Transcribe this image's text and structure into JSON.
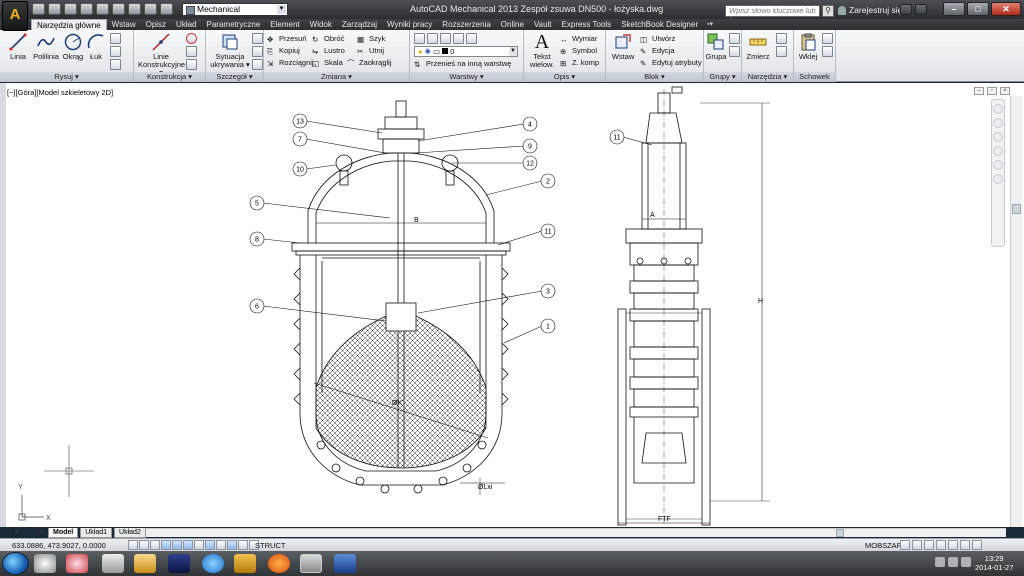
{
  "app": {
    "window_title": "AutoCAD Mechanical 2013     Zespół zsuwa DN500 - łożyska.dwg",
    "app_button_letter": "A",
    "workspace": "Mechanical",
    "search_placeholder": "Wpisz słowo kluczowe lub frazę",
    "sign_in": "Zarejestruj się"
  },
  "ribbon": {
    "tabs": [
      "Narzędzia główne",
      "Wstaw",
      "Opisz",
      "Układ",
      "Parametryczne",
      "Element",
      "Widok",
      "Zarządzaj",
      "Wyniki pracy",
      "Rozszerzenia",
      "Online",
      "Vault",
      "Express Tools",
      "SketchBook Designer"
    ],
    "tabs_toggle": "▪▾",
    "active_tab_index": 0,
    "panels": {
      "rysuj": {
        "title": "Rysuj ▾",
        "linia": "Linia",
        "polilinia": "Polilinia",
        "okrag": "Okrąg",
        "luk": "Łuk"
      },
      "konstrukcja": {
        "title": "Konstrukcja ▾",
        "linie": "Linie",
        "konstrukcyjne": "Konstrukcyjne ▾"
      },
      "szczegol": {
        "title": "Szczegół ▾",
        "sytuacja": "Sytuacja",
        "ukrywania": "ukrywania ▾"
      },
      "zmiana": {
        "title": "Zmiana ▾",
        "przesun": "Przesuń",
        "obroc": "Obróć",
        "szyk": "Szyk",
        "kopiuj": "Kopiuj",
        "lustro": "Lustro",
        "utnij": "Utnij",
        "rozciagnij": "Rozciągnij",
        "skala": "Skala",
        "zaokraglij": "Zaokrąglij"
      },
      "warstwy": {
        "title": "Warstwy ▾",
        "layer_value": "0",
        "przenies": "Przenieś na inną warstwę"
      },
      "opis": {
        "title": "Opis ▾",
        "tekst": "Tekst",
        "wielow": "wielow.",
        "wymiar": "Wymiar",
        "symbol": "Symbol",
        "zkomp": "Z. komp"
      },
      "blok": {
        "title": "Blok ▾",
        "wstaw": "Wstaw",
        "utworz": "Utwórz",
        "edycja": "Edycja",
        "edytuj_atrybuty": "Edytuj atrybuty"
      },
      "grupy": {
        "title": "Grupy ▾",
        "grupa": "Grupa"
      },
      "narzedzia": {
        "title": "Narzędzia ▾",
        "zmierz": "Zmierz"
      },
      "schowek": {
        "title": "Schowek",
        "wklej": "Wklej"
      }
    }
  },
  "viewport": {
    "label": "[−][Góra][Model szkieletowy 2D]"
  },
  "drawing": {
    "balloons_left": [
      "13",
      "7",
      "10",
      "5",
      "8",
      "6"
    ],
    "balloons_right": [
      "4",
      "9",
      "12",
      "2",
      "11",
      "3",
      "1"
    ],
    "balloon_side": "11",
    "dim_B": "B",
    "dim_A": "A",
    "dim_H": "H",
    "dim_FTF": "FTF",
    "dim_K": "ØK",
    "dim_Lxi": "ØLxi",
    "ucs_x": "X",
    "ucs_y": "Y"
  },
  "layout_tabs": [
    "Model",
    "Układ1",
    "Układ2"
  ],
  "status": {
    "coords": "633.0886, 473.9027, 0.0000",
    "struct": "STRUCT",
    "modspace": "MOBSZAR"
  },
  "clock": {
    "time": "13:29",
    "date": "2014-01-27"
  }
}
